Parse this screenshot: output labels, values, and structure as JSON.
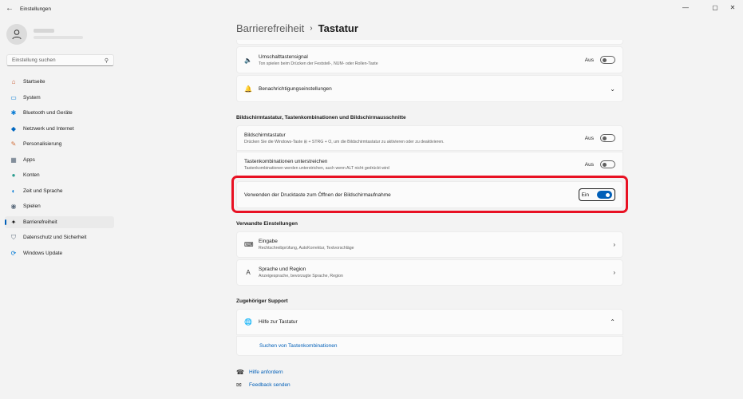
{
  "window": {
    "app_title": "Einstellungen",
    "back_icon": "←",
    "minimize_icon": "—",
    "maximize_icon": "▢",
    "close_icon": "✕"
  },
  "search": {
    "placeholder": "Einstellung suchen",
    "icon": "⚲"
  },
  "nav": [
    {
      "label": "Startseite",
      "icon": "⌂",
      "color": "#c8572b"
    },
    {
      "label": "System",
      "icon": "▭",
      "color": "#0078d4"
    },
    {
      "label": "Bluetooth und Geräte",
      "icon": "✱",
      "color": "#0078d4"
    },
    {
      "label": "Netzwerk und Internet",
      "icon": "◆",
      "color": "#0067c0"
    },
    {
      "label": "Personalisierung",
      "icon": "✎",
      "color": "#d1703c"
    },
    {
      "label": "Apps",
      "icon": "▦",
      "color": "#5b6b7c"
    },
    {
      "label": "Konten",
      "icon": "●",
      "color": "#2a9d8f"
    },
    {
      "label": "Zeit und Sprache",
      "icon": "◐",
      "color": "#0078d4"
    },
    {
      "label": "Spielen",
      "icon": "◉",
      "color": "#5b6b7c"
    },
    {
      "label": "Barrierefreiheit",
      "icon": "✦",
      "color": "#1b1b1b"
    },
    {
      "label": "Datenschutz und Sicherheit",
      "icon": "⛉",
      "color": "#5b6b7c"
    },
    {
      "label": "Windows Update",
      "icon": "⟳",
      "color": "#0078d4"
    }
  ],
  "breadcrumb": {
    "parent": "Barrierefreiheit",
    "separator": "›",
    "current": "Tastatur"
  },
  "cards": {
    "umschalt": {
      "title": "Umschalttastensignal",
      "sub": "Ton spielen beim Drücken der Feststell-, NUM- oder Rollen-Taste",
      "state": "Aus",
      "icon": "🔈"
    },
    "benachricht": {
      "title": "Benachrichtigungseinstellungen",
      "icon": "🔔",
      "chevron": "⌄"
    },
    "bildschirm": {
      "title": "Bildschirmtastatur",
      "sub": "Drücken Sie die Windows-Taste ⊞ + STRG + O, um die Bildschirmtastatur zu aktivieren oder zu deaktivieren.",
      "state": "Aus"
    },
    "tasten": {
      "title": "Tastenkombinationen unterstreichen",
      "sub": "Tastenkombinationen werden unterstrichen, auch wenn ALT nicht gedrückt wird",
      "state": "Aus"
    },
    "druck": {
      "title": "Verwenden der Drucktaste zum Öffnen der Bildschirmaufnahme",
      "state": "Ein"
    },
    "eingabe": {
      "title": "Eingabe",
      "sub": "Rechtschreibprüfung, AutoKorrektur, Textvorschläge",
      "icon": "⌨",
      "chevron": "›"
    },
    "sprache": {
      "title": "Sprache und Region",
      "sub": "Anzeigesprache, bevorzugte Sprache, Region",
      "icon": "A",
      "chevron": "›"
    },
    "hilfe": {
      "title": "Hilfe zur Tastatur",
      "icon": "🌐",
      "chevron": "⌃",
      "link": "Suchen von Tastenkombinationen"
    }
  },
  "sections": {
    "bildschirm": "Bildschirmtastatur, Tastenkombinationen und Bildschirmausschnitte",
    "verwandte": "Verwandte Einstellungen",
    "support": "Zugehöriger Support"
  },
  "footer": {
    "help": {
      "label": "Hilfe anfordern",
      "icon": "☎"
    },
    "feedback": {
      "label": "Feedback senden",
      "icon": "✉"
    }
  },
  "colors": {
    "accent": "#005fb8",
    "highlight": "#e81123"
  }
}
